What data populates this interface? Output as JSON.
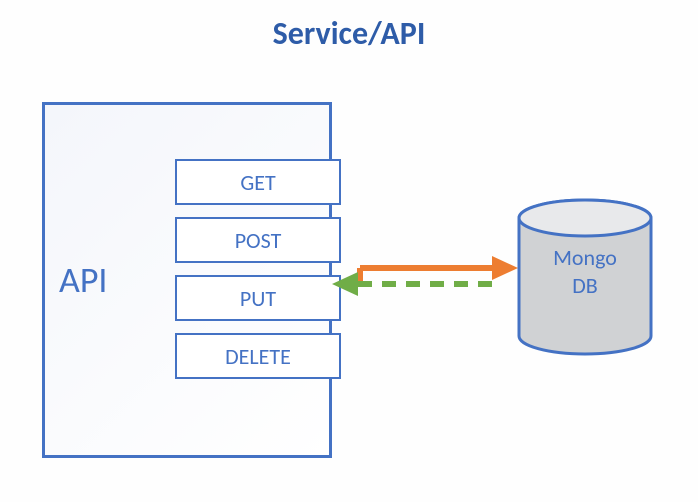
{
  "title": "Service/API",
  "api": {
    "label": "API",
    "methods": [
      "GET",
      "POST",
      "PUT",
      "DELETE"
    ]
  },
  "database": {
    "name_line1": "Mongo",
    "name_line2": "DB"
  },
  "colors": {
    "primary": "#4472c4",
    "title": "#2e5ca8",
    "arrow_right": "#ed7d31",
    "arrow_left": "#70ad47",
    "db_fill": "#d0d2d4"
  }
}
